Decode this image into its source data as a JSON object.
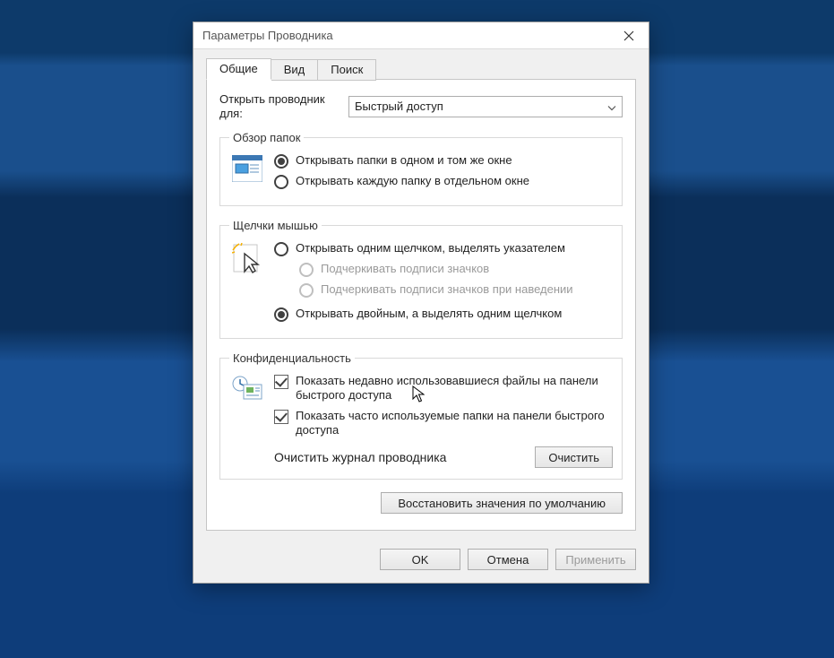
{
  "window": {
    "title": "Параметры Проводника"
  },
  "tabs": {
    "general": "Общие",
    "view": "Вид",
    "search": "Поиск"
  },
  "openfor": {
    "label": "Открыть проводник для:",
    "value": "Быстрый доступ"
  },
  "browse": {
    "legend": "Обзор папок",
    "same_window": "Открывать папки в одном и том же окне",
    "separate_window": "Открывать каждую папку в отдельном окне"
  },
  "click": {
    "legend": "Щелчки мышью",
    "single_click": "Открывать одним щелчком, выделять указателем",
    "underline_always": "Подчеркивать подписи значков",
    "underline_hover": "Подчеркивать подписи значков при наведении",
    "double_click": "Открывать двойным, а выделять одним щелчком"
  },
  "privacy": {
    "legend": "Конфиденциальность",
    "recent_files": "Показать недавно использовавшиеся файлы на панели быстрого доступа",
    "freq_folders": "Показать часто используемые папки на панели быстрого доступа",
    "clear_label": "Очистить журнал проводника",
    "clear_btn": "Очистить"
  },
  "restore_defaults": "Восстановить значения по умолчанию",
  "buttons": {
    "ok": "OK",
    "cancel": "Отмена",
    "apply": "Применить"
  }
}
